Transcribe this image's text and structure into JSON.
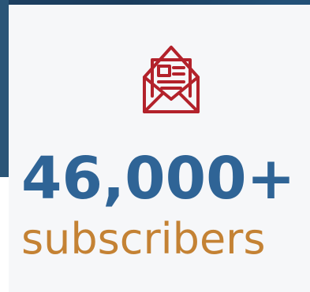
{
  "newsletter_stat": {
    "icon": "open-envelope-newsletter-icon",
    "value": "46,000+",
    "label": "subscribers"
  },
  "colors": {
    "icon": "#b3222b",
    "value": "#2f6496",
    "label": "#c48234",
    "card_background": "#f6f7f9",
    "photo_background": "#1c3f61"
  }
}
